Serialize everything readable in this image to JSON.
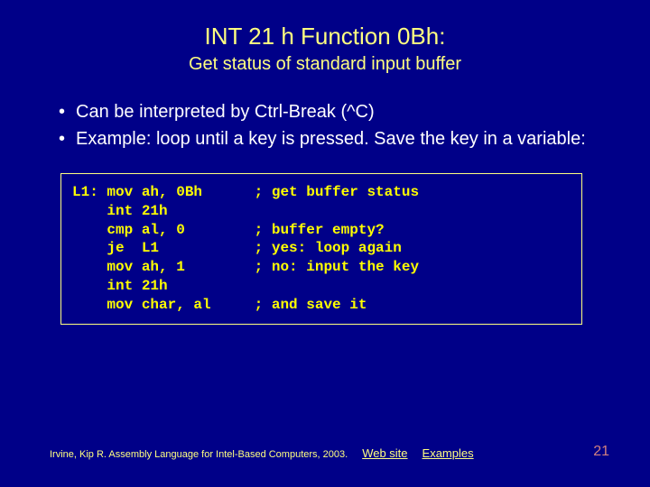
{
  "title": "INT 21 h Function 0Bh:",
  "subtitle": "Get status of standard input buffer",
  "bullets": [
    "Can be interpreted by Ctrl-Break (^C)",
    "Example: loop until a key is pressed. Save the key in a variable:"
  ],
  "code": "L1: mov ah, 0Bh      ; get buffer status\n    int 21h\n    cmp al, 0        ; buffer empty?\n    je  L1           ; yes: loop again\n    mov ah, 1        ; no: input the key\n    int 21h\n    mov char, al     ; and save it",
  "footer": {
    "citation": "Irvine, Kip R. Assembly Language for Intel-Based Computers, 2003.",
    "links": [
      "Web site",
      "Examples"
    ]
  },
  "page_number": "21"
}
